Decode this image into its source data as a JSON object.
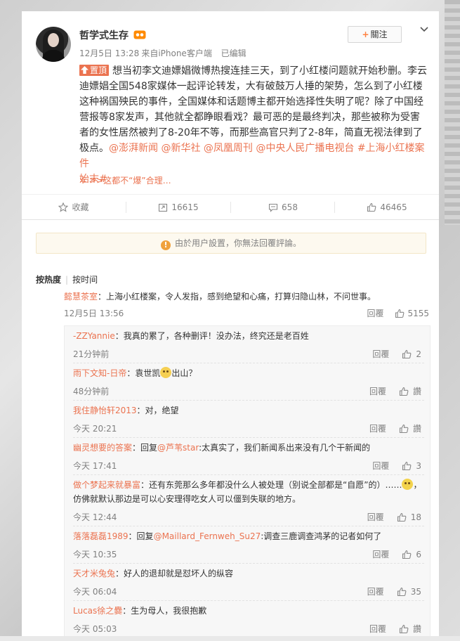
{
  "post": {
    "username": "哲学式生存",
    "date": "12月5日 13:28",
    "source": "来自iPhone客户端",
    "edited": "已编辑",
    "follow_label": "關注",
    "pin_label": "置頂",
    "body": "想当初李文迪嫖娼微博热搜连挂三天，到了小红楼问题就开始秒删。李云迪嫖娼全国548家媒体一起评论转发，大有破鼓万人捶的架势，怎么到了小红楼这种祸国殃民的事件，全国媒体和话题博主都开始选择性失明了呢？除了中国经营报等8家发声，其他就全都睁眼看戏？最可恶的是最终判决，那些被称为受害者的女性居然被判了8-20年不等，而那些高官只判了2-8年，简直无视法律到了极点。",
    "mentions": [
      "@澎湃新闻",
      "@新华社",
      "@凤凰周刊",
      "@中央人民广播电视台"
    ],
    "hashtag_a": "#上海小红楼案件",
    "hashtag_b": "始末#",
    "hidden_hint": ">>这都不“爆”合理…",
    "actions": {
      "favorite": "收藏",
      "repost": "16615",
      "comment": "658",
      "like": "46465"
    }
  },
  "comments": {
    "notice": "由於用户設置，你無法回覆評論。",
    "sort_hot": "按热度",
    "sort_time": "按时间",
    "top": {
      "name": "懿慧茶室",
      "text": "：上海小红楼案，令人发指，感到绝望和心痛，打算归隐山林，不问世事。",
      "time": "12月5日 13:56",
      "reply": "回覆",
      "likes": "5155"
    },
    "replies": [
      {
        "name": "-ZZYannie",
        "pre": "：我真的累了，各种删评！没办法，终究还是老百姓",
        "mention": "",
        "post": "",
        "extra": "",
        "time": "21分钟前",
        "reply": "回覆",
        "likes": "2"
      },
      {
        "name": "雨下文知-日帝",
        "pre": "：袁世凯",
        "mention": "",
        "post": "出山？",
        "extra": "",
        "time": "48分钟前",
        "reply": "回覆",
        "likes": "讚"
      },
      {
        "name": "我住静怡轩2013",
        "pre": "：对，绝望",
        "mention": "",
        "post": "",
        "extra": "",
        "time": "今天 20:21",
        "reply": "回覆",
        "likes": "讚"
      },
      {
        "name": "幽灵想要的答案",
        "pre": "：回复",
        "mention": "@芦苇star",
        "post": ":太真实了，我们新闻系出来没有几个干新闻的",
        "extra": "",
        "time": "今天 17:41",
        "reply": "回覆",
        "likes": "3"
      },
      {
        "name": "做个梦起来就暴富",
        "pre": "：还有东莞那么多年都没什么人被处理（别说全部都是“自愿”的）……",
        "mention": "",
        "post": "，",
        "extra": "仿佛就默认那边是可以心安理得吃女人可以僵到失联的地方。",
        "time": "今天 12:44",
        "reply": "回覆",
        "likes": "18"
      },
      {
        "name": "落落磊磊1989",
        "pre": "：回复",
        "mention": "@Maillard_Fernweh_Su27",
        "post": ":调查三鹿调查鸿茅的记者如何了",
        "extra": "",
        "time": "今天 10:35",
        "reply": "回覆",
        "likes": "6"
      },
      {
        "name": "天才米兔兔",
        "pre": "：好人的退却就是怼坏人的纵容",
        "mention": "",
        "post": "",
        "extra": "",
        "time": "今天 06:04",
        "reply": "回覆",
        "likes": "35"
      },
      {
        "name": "Lucas徐之爨",
        "pre": "：生为母人，我很抱歉",
        "mention": "",
        "post": "",
        "extra": "",
        "time": "今天 05:03",
        "reply": "回覆",
        "likes": "讚"
      }
    ]
  }
}
